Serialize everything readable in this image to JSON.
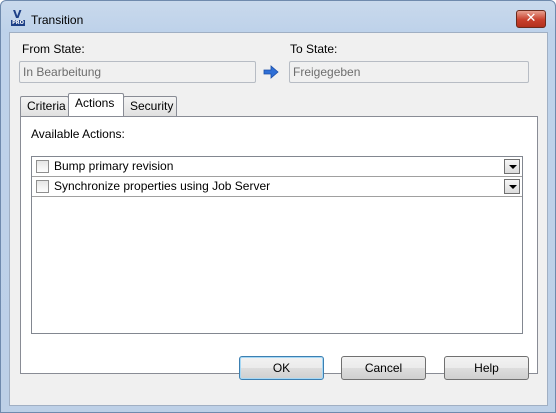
{
  "window": {
    "title": "Transition",
    "app_icon": "vault-pro-icon",
    "close_label": "✕"
  },
  "from_state": {
    "label": "From State:",
    "value": "In Bearbeitung"
  },
  "to_state": {
    "label": "To State:",
    "value": "Freigegeben"
  },
  "tabs": [
    {
      "label": "Criteria",
      "active": false
    },
    {
      "label": "Actions",
      "active": true
    },
    {
      "label": "Security",
      "active": false
    }
  ],
  "actions_panel": {
    "heading": "Available Actions:",
    "items": [
      {
        "label": "Bump primary revision",
        "checked": false
      },
      {
        "label": "Synchronize properties using Job Server",
        "checked": false
      }
    ]
  },
  "buttons": {
    "ok": "OK",
    "cancel": "Cancel",
    "help": "Help"
  },
  "colors": {
    "accent_arrow": "#2f6fd6",
    "close_button": "#c8402c"
  }
}
